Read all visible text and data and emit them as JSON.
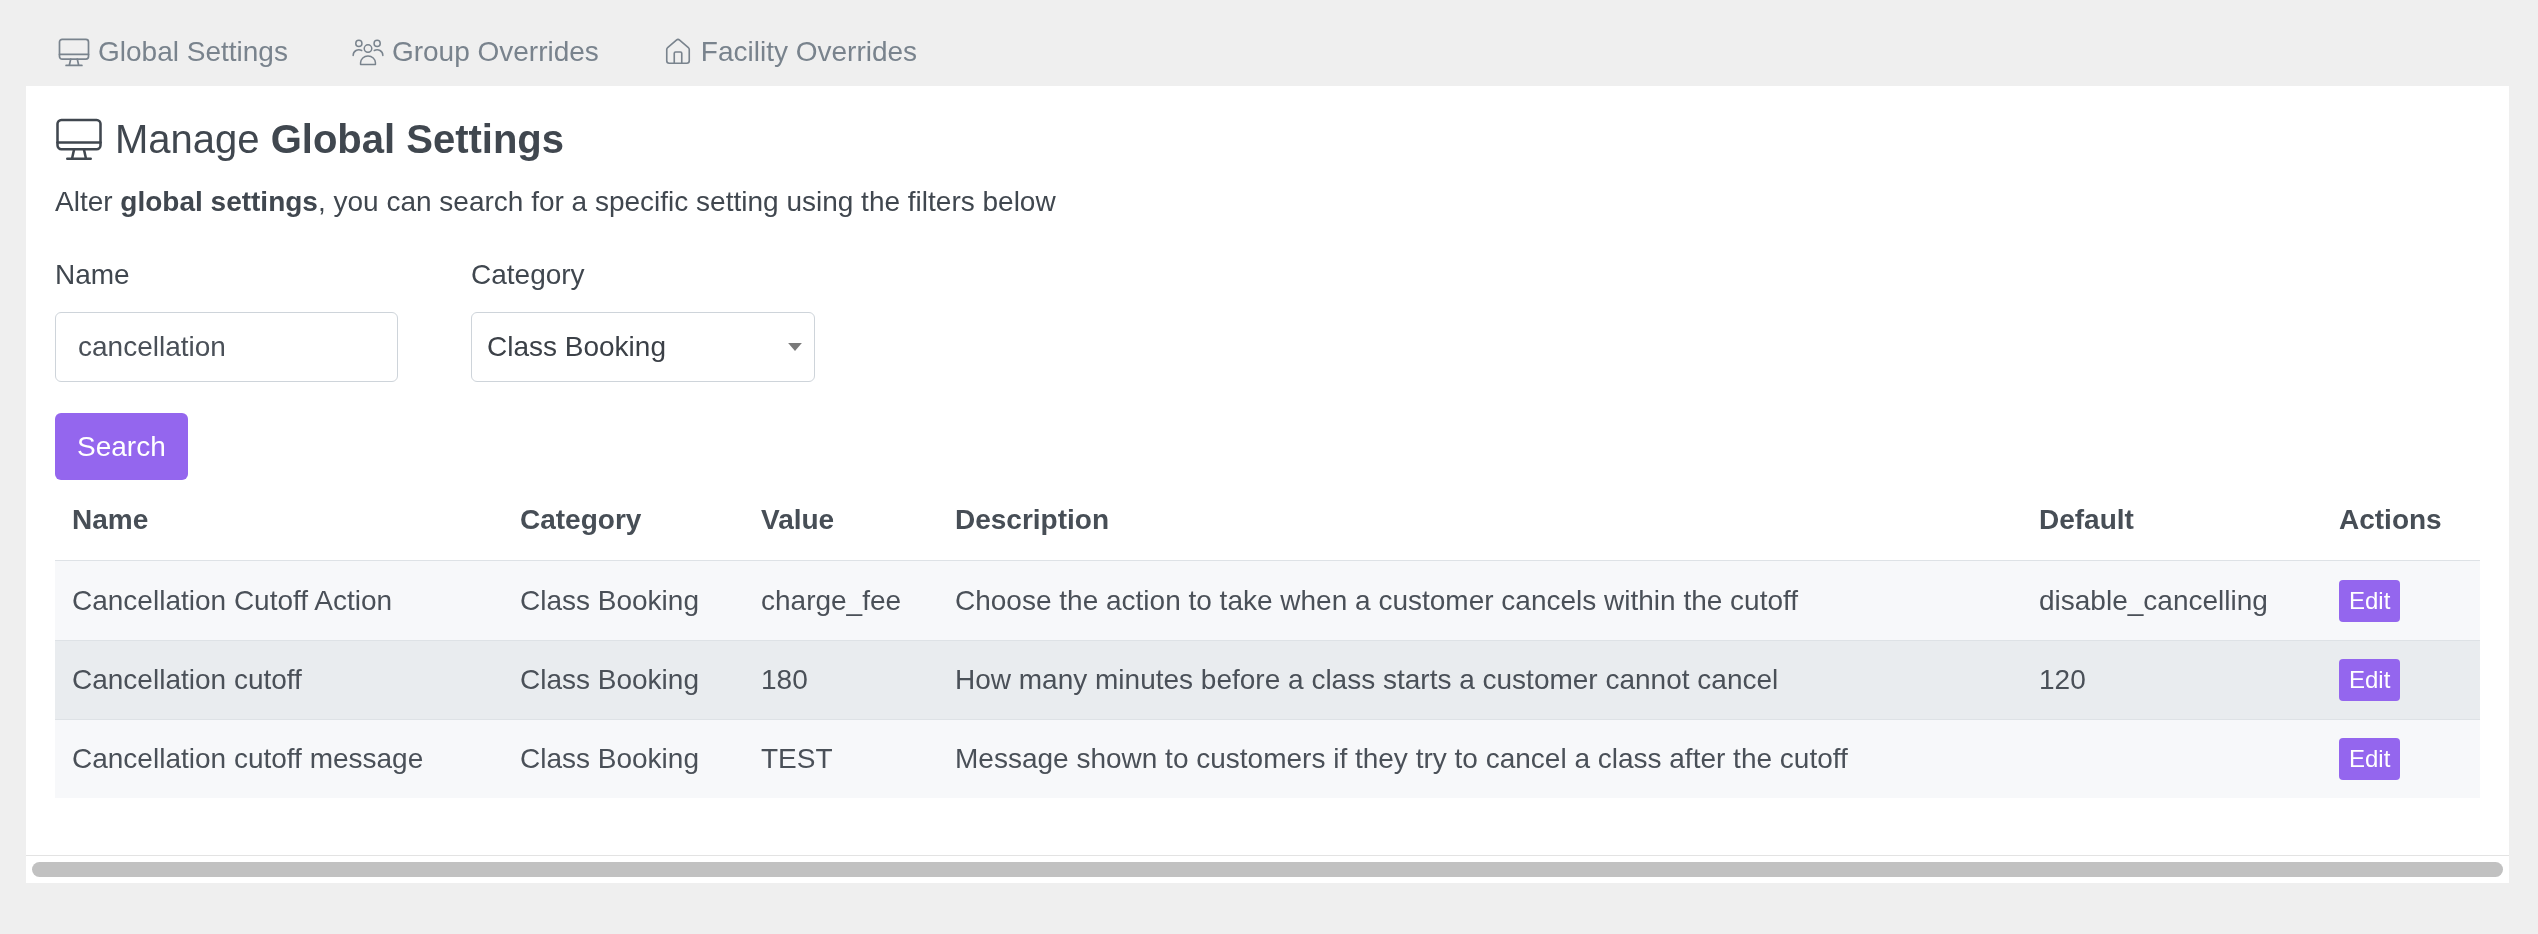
{
  "tabs": [
    {
      "label": "Global Settings"
    },
    {
      "label": "Group Overrides"
    },
    {
      "label": "Facility Overrides"
    }
  ],
  "header": {
    "title": "Manage **Global Settings**",
    "description": "Alter **global settings**, you can search for a specific setting using the filters below"
  },
  "filters": {
    "name": {
      "label": "Name",
      "value": "cancellation"
    },
    "category": {
      "label": "Category",
      "value": "Class Booking"
    },
    "search_button": "Search"
  },
  "table": {
    "columns": [
      "Name",
      "Category",
      "Value",
      "Description",
      "Default",
      "Actions"
    ],
    "rows": [
      {
        "name": "Cancellation Cutoff Action",
        "category": "Class Booking",
        "value": "charge_fee",
        "description": "Choose the action to take when a customer cancels within the cutoff",
        "default": "disable_cancelling",
        "action": "Edit",
        "hovered": false
      },
      {
        "name": "Cancellation cutoff",
        "category": "Class Booking",
        "value": "180",
        "description": "How many minutes before a class starts a customer cannot cancel",
        "default": "120",
        "action": "Edit",
        "hovered": true
      },
      {
        "name": "Cancellation cutoff message",
        "category": "Class Booking",
        "value": "TEST",
        "description": "Message shown to customers if they try to cancel a class after the cutoff",
        "action": "Edit",
        "hovered": false
      }
    ]
  }
}
